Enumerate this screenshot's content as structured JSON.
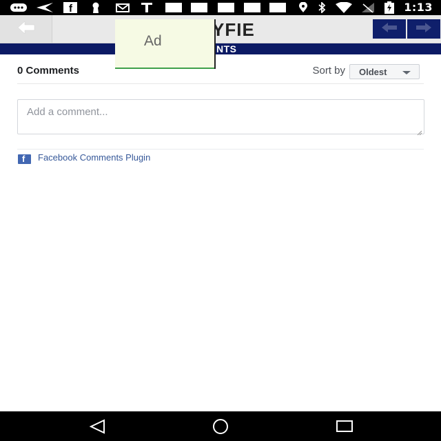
{
  "status_bar": {
    "time": "1:13",
    "icons": [
      "messaging-icon",
      "send-icon",
      "facebook-icon",
      "keyhole-icon",
      "mail-icon",
      "text-icon",
      "location-icon",
      "bluetooth-icon",
      "wifi-icon",
      "no-signal-icon",
      "battery-charging-icon"
    ]
  },
  "app_header": {
    "logo_text": "YFIE",
    "title": "MENTS",
    "back_icon": "arrow-left-icon",
    "prev_icon": "arrow-left-icon",
    "next_icon": "arrow-right-icon",
    "accent_color": "#0c1a64"
  },
  "ad": {
    "label": "Ad"
  },
  "comments": {
    "count_label": "0 Comments",
    "sort_label": "Sort by",
    "sort_value": "Oldest",
    "input_placeholder": "Add a comment...",
    "plugin_label": "Facebook Comments Plugin",
    "plugin_icon_letter": "f"
  },
  "nav_bar": {
    "icons": [
      "back-triangle-icon",
      "home-circle-icon",
      "recents-square-icon"
    ]
  }
}
